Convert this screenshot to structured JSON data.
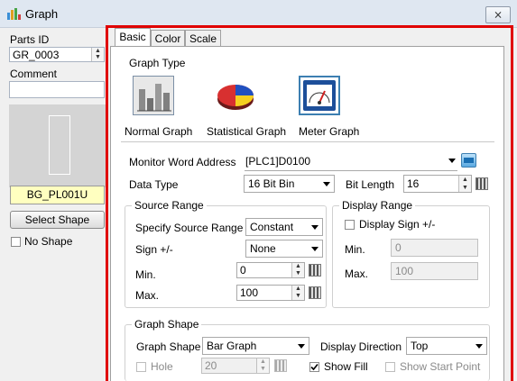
{
  "window": {
    "title": "Graph",
    "close_label": "⨯"
  },
  "left": {
    "parts_id_label": "Parts ID",
    "parts_id_value": "GR_0003",
    "comment_label": "Comment",
    "comment_value": "",
    "background_label": "BG_PL001U",
    "select_shape_label": "Select Shape",
    "no_shape_label": "No Shape"
  },
  "tabs": [
    {
      "label": "Basic"
    },
    {
      "label": "Color"
    },
    {
      "label": "Scale"
    }
  ],
  "graph_type": {
    "label": "Graph Type",
    "options": [
      {
        "label": "Normal Graph",
        "icon": "bar-chart-icon"
      },
      {
        "label": "Statistical Graph",
        "icon": "pie-chart-icon"
      },
      {
        "label": "Meter Graph",
        "icon": "meter-icon"
      }
    ],
    "selected": "Meter Graph"
  },
  "monitor": {
    "label": "Monitor Word Address",
    "value": "[PLC1]D0100"
  },
  "data_type": {
    "label": "Data Type",
    "value": "16 Bit Bin"
  },
  "bit_length": {
    "label": "Bit Length",
    "value": "16"
  },
  "source_range": {
    "title": "Source Range",
    "specify_label": "Specify Source Range",
    "specify_value": "Constant",
    "sign_label": "Sign +/-",
    "sign_value": "None",
    "min_label": "Min.",
    "min_value": "0",
    "max_label": "Max.",
    "max_value": "100"
  },
  "display_range": {
    "title": "Display Range",
    "display_sign_label": "Display Sign +/-",
    "min_label": "Min.",
    "min_value": "0",
    "max_label": "Max.",
    "max_value": "100"
  },
  "graph_shape": {
    "title": "Graph Shape",
    "shape_label": "Graph Shape",
    "shape_value": "Bar Graph",
    "direction_label": "Display Direction",
    "direction_value": "Top",
    "hole_label": "Hole",
    "hole_value": "20",
    "show_fill_label": "Show Fill",
    "show_fill_checked": true,
    "show_start_label": "Show Start Point"
  },
  "colors": {
    "accent_frame": "#e00000",
    "selected_border": "#3c7fb1",
    "background_label": "#ffffc0"
  }
}
